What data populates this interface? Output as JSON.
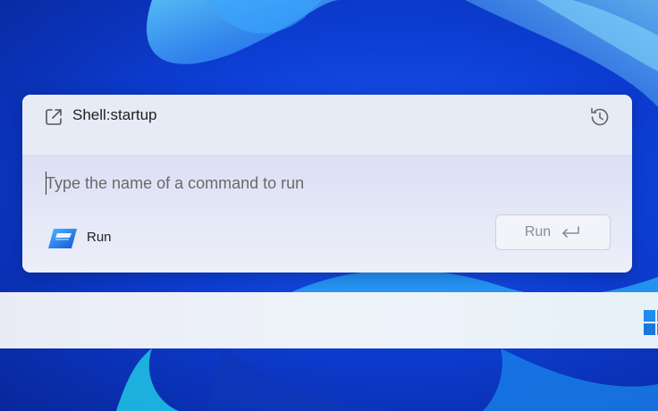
{
  "dialog": {
    "suggestion": {
      "text": "Shell:startup",
      "icon": "open-external-icon"
    },
    "history_icon": "history-icon",
    "input": {
      "value": "",
      "placeholder": "Type the name of a command to run"
    },
    "app": {
      "label": "Run",
      "icon": "run-app-icon"
    },
    "run_button": {
      "label": "Run",
      "icon": "enter-icon"
    }
  },
  "taskbar": {
    "start_icon": "windows-start-icon"
  },
  "colors": {
    "wallpaper": "#0d3fd6",
    "accent": "#1e6fe8",
    "dialog_bg": "#e7ebf6",
    "taskbar_bg": "#eef2f9"
  }
}
